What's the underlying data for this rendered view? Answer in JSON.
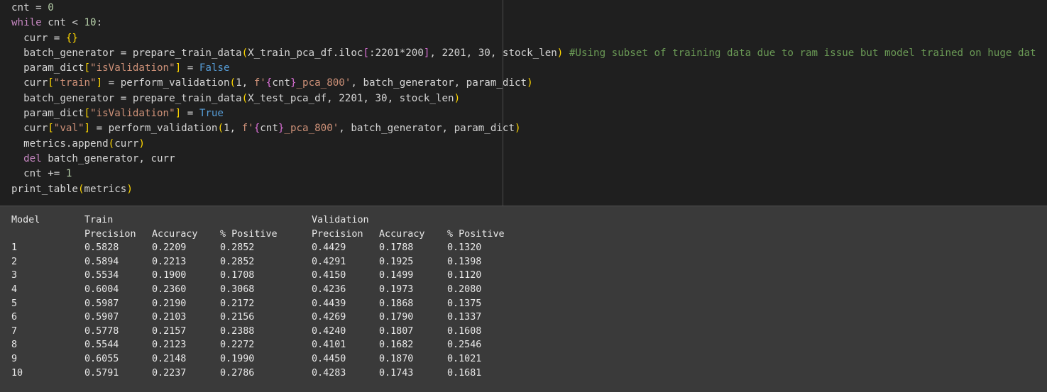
{
  "code": {
    "lines": [
      [
        {
          "t": "cnt = ",
          "c": "txt"
        },
        {
          "t": "0",
          "c": "num"
        }
      ],
      [
        {
          "t": "while",
          "c": "kw"
        },
        {
          "t": " cnt < ",
          "c": "txt"
        },
        {
          "t": "10",
          "c": "num"
        },
        {
          "t": ":",
          "c": "txt"
        }
      ],
      [
        {
          "t": "  curr = ",
          "c": "txt"
        },
        {
          "t": "{}",
          "c": "br"
        }
      ],
      [
        {
          "t": "  batch_generator = prepare_train_data",
          "c": "txt"
        },
        {
          "t": "(",
          "c": "br"
        },
        {
          "t": "X_train_pca_df.iloc",
          "c": "txt"
        },
        {
          "t": "[",
          "c": "br2"
        },
        {
          "t": ":2201*200",
          "c": "txt"
        },
        {
          "t": "]",
          "c": "br2"
        },
        {
          "t": ", 2201, 30, stock_len",
          "c": "txt"
        },
        {
          "t": ")",
          "c": "br"
        },
        {
          "t": " #Using subset of training data due to ram issue but model trained on huge dat",
          "c": "com"
        }
      ],
      [
        {
          "t": "  param_dict",
          "c": "txt"
        },
        {
          "t": "[",
          "c": "br"
        },
        {
          "t": "\"isValidation\"",
          "c": "str"
        },
        {
          "t": "]",
          "c": "br"
        },
        {
          "t": " = ",
          "c": "txt"
        },
        {
          "t": "False",
          "c": "bool"
        }
      ],
      [
        {
          "t": "  curr",
          "c": "txt"
        },
        {
          "t": "[",
          "c": "br"
        },
        {
          "t": "\"train\"",
          "c": "str"
        },
        {
          "t": "]",
          "c": "br"
        },
        {
          "t": " = perform_validation",
          "c": "txt"
        },
        {
          "t": "(",
          "c": "br"
        },
        {
          "t": "1, ",
          "c": "txt"
        },
        {
          "t": "f'",
          "c": "str"
        },
        {
          "t": "{",
          "c": "br2"
        },
        {
          "t": "cnt",
          "c": "txt"
        },
        {
          "t": "}",
          "c": "br2"
        },
        {
          "t": "_pca_800'",
          "c": "str"
        },
        {
          "t": ", batch_generator, param_dict",
          "c": "txt"
        },
        {
          "t": ")",
          "c": "br"
        }
      ],
      [
        {
          "t": "  batch_generator = prepare_train_data",
          "c": "txt"
        },
        {
          "t": "(",
          "c": "br"
        },
        {
          "t": "X_test_pca_df, 2201, 30, stock_len",
          "c": "txt"
        },
        {
          "t": ")",
          "c": "br"
        }
      ],
      [
        {
          "t": "  param_dict",
          "c": "txt"
        },
        {
          "t": "[",
          "c": "br"
        },
        {
          "t": "\"isValidation\"",
          "c": "str"
        },
        {
          "t": "]",
          "c": "br"
        },
        {
          "t": " = ",
          "c": "txt"
        },
        {
          "t": "True",
          "c": "bool"
        }
      ],
      [
        {
          "t": "  curr",
          "c": "txt"
        },
        {
          "t": "[",
          "c": "br"
        },
        {
          "t": "\"val\"",
          "c": "str"
        },
        {
          "t": "]",
          "c": "br"
        },
        {
          "t": " = perform_validation",
          "c": "txt"
        },
        {
          "t": "(",
          "c": "br"
        },
        {
          "t": "1, ",
          "c": "txt"
        },
        {
          "t": "f'",
          "c": "str"
        },
        {
          "t": "{",
          "c": "br2"
        },
        {
          "t": "cnt",
          "c": "txt"
        },
        {
          "t": "}",
          "c": "br2"
        },
        {
          "t": "_pca_800'",
          "c": "str"
        },
        {
          "t": ", batch_generator, param_dict",
          "c": "txt"
        },
        {
          "t": ")",
          "c": "br"
        }
      ],
      [
        {
          "t": "  metrics.append",
          "c": "txt"
        },
        {
          "t": "(",
          "c": "br"
        },
        {
          "t": "curr",
          "c": "txt"
        },
        {
          "t": ")",
          "c": "br"
        }
      ],
      [
        {
          "t": "  ",
          "c": "txt"
        },
        {
          "t": "del",
          "c": "kw"
        },
        {
          "t": " batch_generator, curr",
          "c": "txt"
        }
      ],
      [
        {
          "t": "  cnt += ",
          "c": "txt"
        },
        {
          "t": "1",
          "c": "num"
        }
      ],
      [
        {
          "t": "print_table",
          "c": "txt"
        },
        {
          "t": "(",
          "c": "br"
        },
        {
          "t": "metrics",
          "c": "txt"
        },
        {
          "t": ")",
          "c": "br"
        }
      ]
    ]
  },
  "output": {
    "header1": {
      "model": "Model",
      "train": "Train",
      "validation": "Validation"
    },
    "header2": {
      "train_precision": "Precision",
      "train_accuracy": "Accuracy",
      "train_positive": "% Positive",
      "val_precision": "Precision",
      "val_accuracy": "Accuracy",
      "val_positive": "% Positive"
    },
    "rows": [
      [
        "1",
        "0.5828",
        "0.2209",
        "0.2852",
        "0.4429",
        "0.1788",
        "0.1320"
      ],
      [
        "2",
        "0.5894",
        "0.2213",
        "0.2852",
        "0.4291",
        "0.1925",
        "0.1398"
      ],
      [
        "3",
        "0.5534",
        "0.1900",
        "0.1708",
        "0.4150",
        "0.1499",
        "0.1120"
      ],
      [
        "4",
        "0.6004",
        "0.2360",
        "0.3068",
        "0.4236",
        "0.1973",
        "0.2080"
      ],
      [
        "5",
        "0.5987",
        "0.2190",
        "0.2172",
        "0.4439",
        "0.1868",
        "0.1375"
      ],
      [
        "6",
        "0.5907",
        "0.2103",
        "0.2156",
        "0.4269",
        "0.1790",
        "0.1337"
      ],
      [
        "7",
        "0.5778",
        "0.2157",
        "0.2388",
        "0.4240",
        "0.1807",
        "0.1608"
      ],
      [
        "8",
        "0.5544",
        "0.2123",
        "0.2272",
        "0.4101",
        "0.1682",
        "0.2546"
      ],
      [
        "9",
        "0.6055",
        "0.2148",
        "0.1990",
        "0.4450",
        "0.1870",
        "0.1021"
      ],
      [
        "10",
        "0.5791",
        "0.2237",
        "0.2786",
        "0.4283",
        "0.1743",
        "0.1681"
      ]
    ]
  },
  "colors": {
    "editor_bg": "#1f1f1f",
    "output_bg": "#3a3a3a",
    "keyword": "#c586c0",
    "number": "#b5cea8",
    "string": "#ce9178",
    "boolean": "#569cd6",
    "comment": "#6a9955",
    "bracket": "#ffd700",
    "bracket_nested": "#da70d6"
  }
}
